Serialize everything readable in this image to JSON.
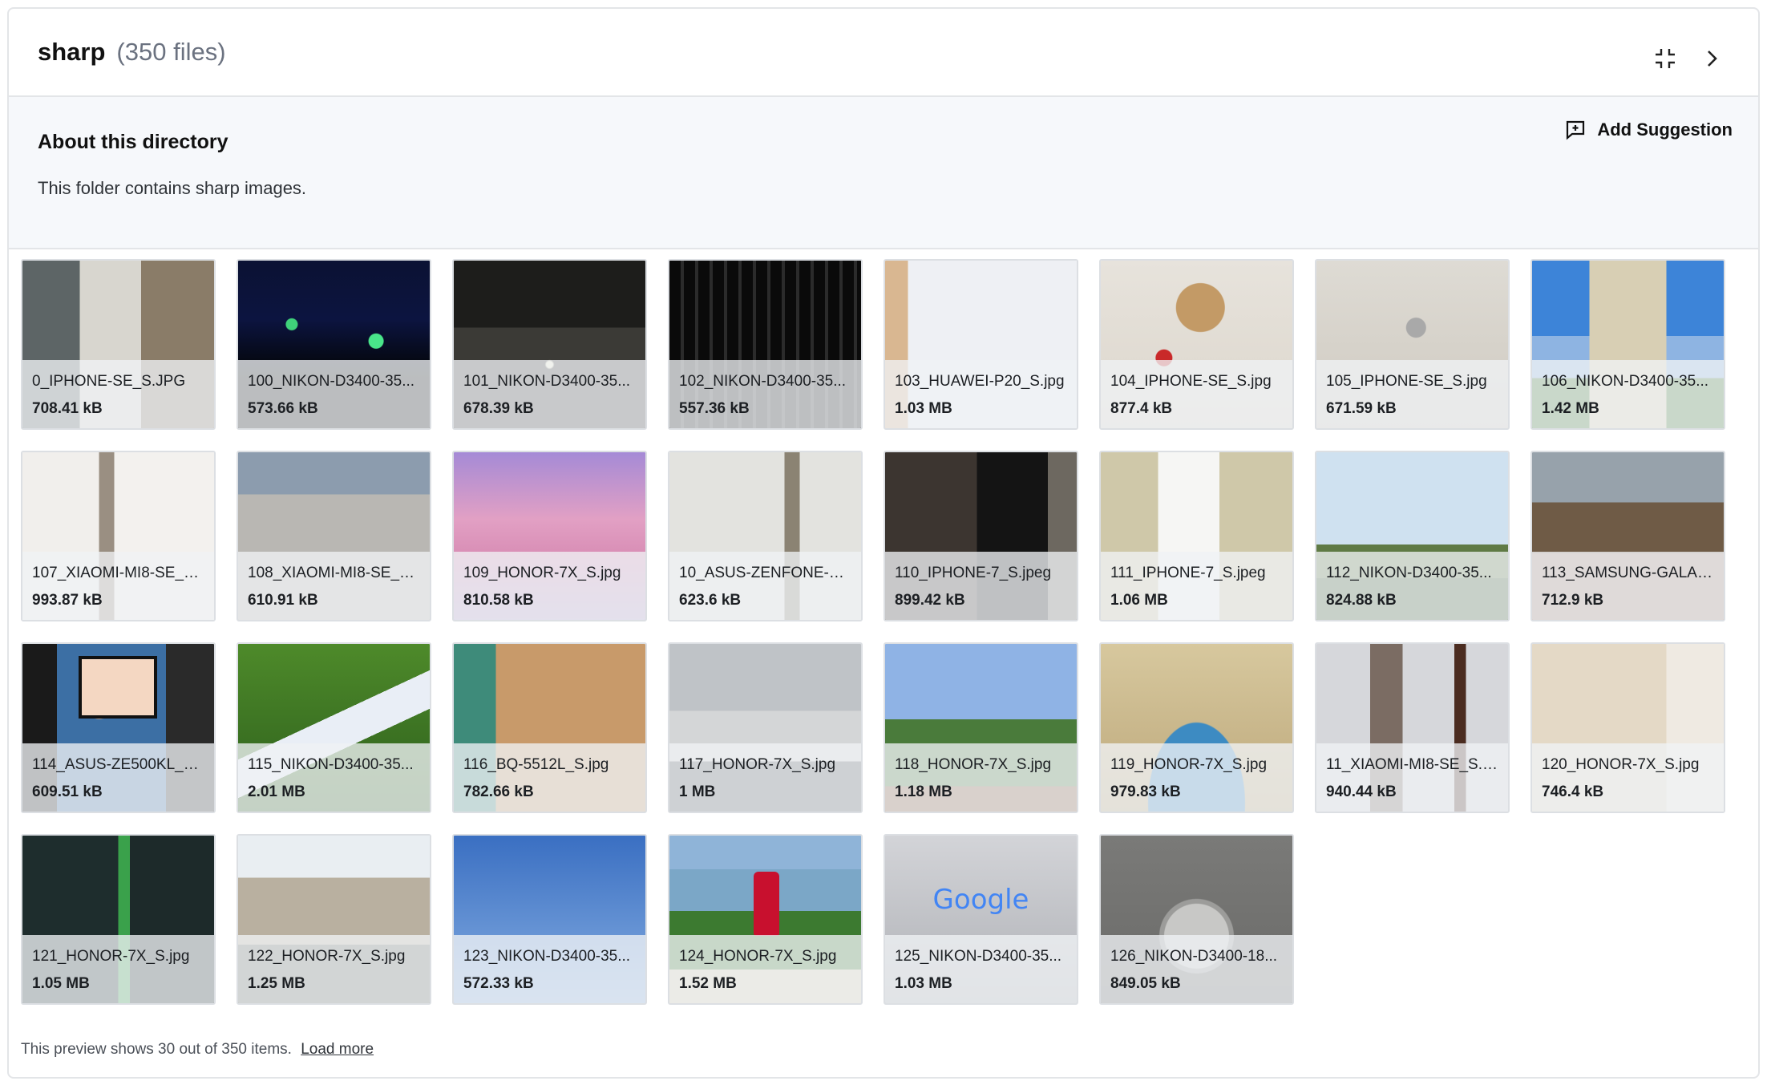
{
  "header": {
    "title": "sharp",
    "count": "(350 files)"
  },
  "icons": {
    "collapse": "collapse-icon",
    "next": "chevron-right-icon",
    "suggest": "comment-plus-icon"
  },
  "about": {
    "title": "About this directory",
    "description": "This folder contains sharp images.",
    "suggest_label": "Add Suggestion"
  },
  "files": [
    {
      "name": "0_IPHONE-SE_S.JPG",
      "size": "708.41 kB"
    },
    {
      "name": "100_NIKON-D3400-35...",
      "size": "573.66 kB"
    },
    {
      "name": "101_NIKON-D3400-35...",
      "size": "678.39 kB"
    },
    {
      "name": "102_NIKON-D3400-35...",
      "size": "557.36 kB"
    },
    {
      "name": "103_HUAWEI-P20_S.jpg",
      "size": "1.03 MB"
    },
    {
      "name": "104_IPHONE-SE_S.jpg",
      "size": "877.4 kB"
    },
    {
      "name": "105_IPHONE-SE_S.jpg",
      "size": "671.59 kB"
    },
    {
      "name": "106_NIKON-D3400-35...",
      "size": "1.42 MB"
    },
    {
      "name": "107_XIAOMI-MI8-SE_S....",
      "size": "993.87 kB"
    },
    {
      "name": "108_XIAOMI-MI8-SE_S...",
      "size": "610.91 kB"
    },
    {
      "name": "109_HONOR-7X_S.jpg",
      "size": "810.58 kB"
    },
    {
      "name": "10_ASUS-ZENFONE-LI...",
      "size": "623.6 kB"
    },
    {
      "name": "110_IPHONE-7_S.jpeg",
      "size": "899.42 kB"
    },
    {
      "name": "111_IPHONE-7_S.jpeg",
      "size": "1.06 MB"
    },
    {
      "name": "112_NIKON-D3400-35...",
      "size": "824.88 kB"
    },
    {
      "name": "113_SAMSUNG-GALAX...",
      "size": "712.9 kB"
    },
    {
      "name": "114_ASUS-ZE500KL_S....",
      "size": "609.51 kB"
    },
    {
      "name": "115_NIKON-D3400-35...",
      "size": "2.01 MB"
    },
    {
      "name": "116_BQ-5512L_S.jpg",
      "size": "782.66 kB"
    },
    {
      "name": "117_HONOR-7X_S.jpg",
      "size": "1 MB"
    },
    {
      "name": "118_HONOR-7X_S.jpg",
      "size": "1.18 MB"
    },
    {
      "name": "119_HONOR-7X_S.jpg",
      "size": "979.83 kB"
    },
    {
      "name": "11_XIAOMI-MI8-SE_S.jpg",
      "size": "940.44 kB"
    },
    {
      "name": "120_HONOR-7X_S.jpg",
      "size": "746.4 kB"
    },
    {
      "name": "121_HONOR-7X_S.jpg",
      "size": "1.05 MB"
    },
    {
      "name": "122_HONOR-7X_S.jpg",
      "size": "1.25 MB"
    },
    {
      "name": "123_NIKON-D3400-35...",
      "size": "572.33 kB"
    },
    {
      "name": "124_HONOR-7X_S.jpg",
      "size": "1.52 MB"
    },
    {
      "name": "125_NIKON-D3400-35...",
      "size": "1.03 MB"
    },
    {
      "name": "126_NIKON-D3400-18...",
      "size": "849.05 kB"
    }
  ],
  "thumb_text": {
    "google": "Google"
  },
  "footer": {
    "text": "This preview shows 30 out of 350 items.",
    "load_more": "Load more"
  }
}
